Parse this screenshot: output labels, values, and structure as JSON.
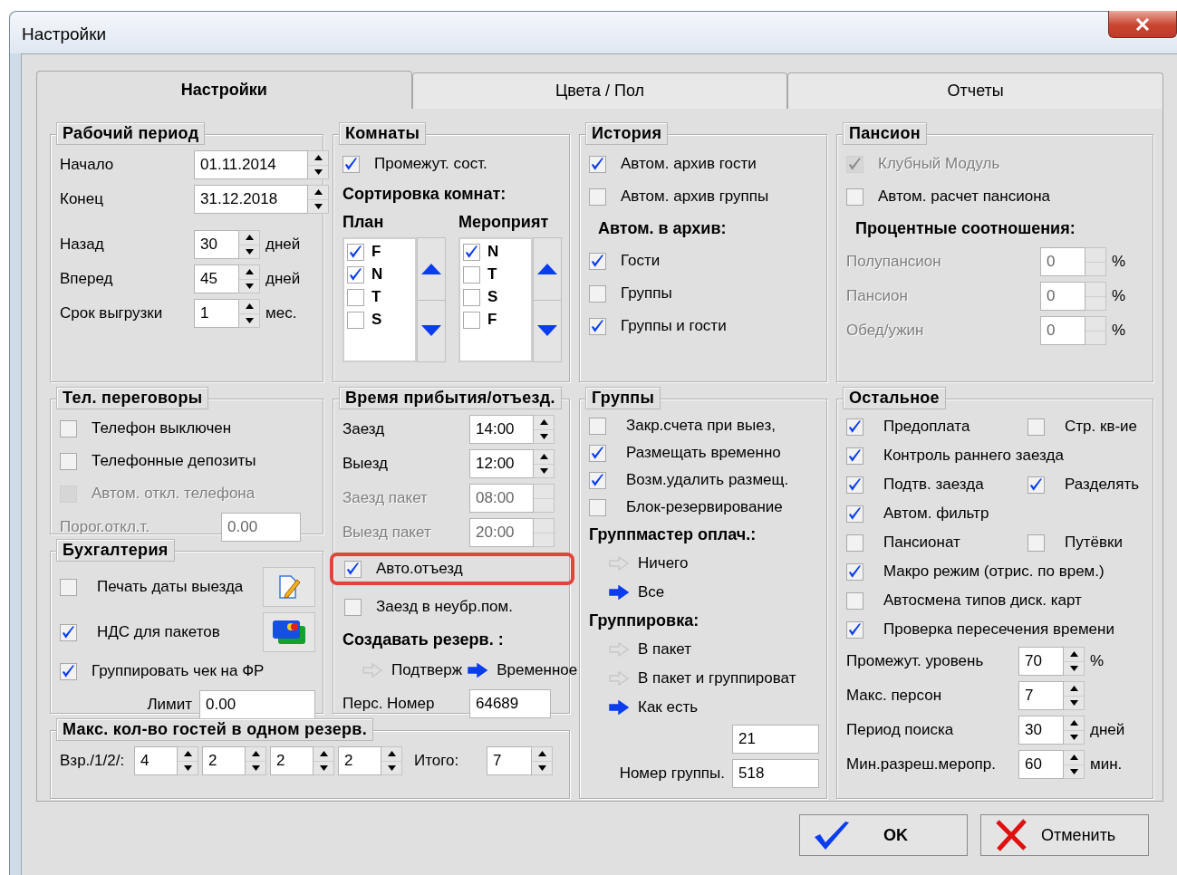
{
  "window": {
    "title": "Настройки"
  },
  "tabs": [
    {
      "label": "Настройки",
      "selected": true
    },
    {
      "label": "Цвета / Пол",
      "selected": false
    },
    {
      "label": "Отчеты",
      "selected": false
    }
  ],
  "groups": [
    {
      "title": "Рабочий период",
      "items": [
        {
          "kind": "spin",
          "label": "Начало",
          "value": "01.11.2014"
        },
        {
          "kind": "spin",
          "label": "Конец",
          "value": "31.12.2018"
        },
        {
          "kind": "gap"
        },
        {
          "kind": "spin",
          "label": "Назад",
          "value": "30",
          "unit": "дней"
        },
        {
          "kind": "spin",
          "label": "Вперед",
          "value": "45",
          "unit": "дней"
        },
        {
          "kind": "spin",
          "label": "Срок выгрузки",
          "value": "1",
          "unit": "мес."
        }
      ]
    },
    {
      "title": "Комнаты",
      "items": [
        {
          "kind": "checkbox",
          "label": "Промежут. сост.",
          "checked": true
        },
        {
          "kind": "heading",
          "text": "Сортировка комнат:"
        },
        {
          "kind": "sorter",
          "lists": [
            {
              "title": "План",
              "entries": [
                {
                  "label": "F",
                  "checked": true
                },
                {
                  "label": "N",
                  "checked": true
                },
                {
                  "label": "T",
                  "checked": false
                },
                {
                  "label": "S",
                  "checked": false
                }
              ]
            },
            {
              "title": "Мероприят",
              "entries": [
                {
                  "label": "N",
                  "checked": true
                },
                {
                  "label": "T",
                  "checked": false
                },
                {
                  "label": "S",
                  "checked": false
                },
                {
                  "label": "F",
                  "checked": false
                }
              ]
            }
          ]
        }
      ]
    },
    {
      "title": "История",
      "items": [
        {
          "kind": "checkbox",
          "label": "Автом. архив гости",
          "checked": true
        },
        {
          "kind": "checkbox",
          "label": "Автом. архив группы",
          "checked": false
        },
        {
          "kind": "heading",
          "text": "Автом. в архив:"
        },
        {
          "kind": "checkbox",
          "label": "Гости",
          "checked": true
        },
        {
          "kind": "checkbox",
          "label": "Группы",
          "checked": false
        },
        {
          "kind": "checkbox",
          "label": "Группы и гости",
          "checked": true
        }
      ]
    },
    {
      "title": "Пансион",
      "items": [
        {
          "kind": "checkbox",
          "label": "Клубный Модуль",
          "checked": true,
          "disabled": true
        },
        {
          "kind": "checkbox",
          "label": "Автом. расчет пансиона",
          "checked": false,
          "disabled": false
        },
        {
          "kind": "heading",
          "text": "Процентные соотношения:",
          "disabled": false
        },
        {
          "kind": "spin",
          "label": "Полупансион",
          "value": "0",
          "unit": "%",
          "disabled": true
        },
        {
          "kind": "spin",
          "label": "Пансион",
          "value": "0",
          "unit": "%",
          "disabled": true
        },
        {
          "kind": "spin",
          "label": "Обед/ужин",
          "value": "0",
          "unit": "%",
          "disabled": true
        }
      ]
    },
    {
      "title": "Тел. переговоры",
      "items": [
        {
          "kind": "checkbox",
          "label": "Телефон выключен",
          "checked": false,
          "disabled": false
        },
        {
          "kind": "checkbox",
          "label": "Телефонные депозиты",
          "checked": false,
          "disabled": false
        },
        {
          "kind": "checkbox",
          "label": "Автом. откл. телефона",
          "checked": false,
          "disabled": true
        },
        {
          "kind": "field",
          "label": "Порог.откл.т.",
          "value": "0.00",
          "disabled": true
        }
      ]
    },
    {
      "title": "Время прибытия/отъезд.",
      "items": [
        {
          "kind": "spin",
          "label": "Заезд",
          "value": "14:00",
          "disabled": false
        },
        {
          "kind": "spin",
          "label": "Выезд",
          "value": "12:00",
          "disabled": false
        },
        {
          "kind": "spin",
          "label": "Заезд пакет",
          "value": "08:00",
          "disabled": true
        },
        {
          "kind": "spin",
          "label": "Выезд пакет",
          "value": "20:00",
          "disabled": true
        },
        {
          "kind": "checkbox",
          "label": "Авто.отъезд",
          "checked": true,
          "disabled": false,
          "highlighted": true
        },
        {
          "kind": "checkbox",
          "label": "Заезд в неубр.пом.",
          "checked": false,
          "disabled": false,
          "highlighted": false
        },
        {
          "kind": "heading",
          "text": "Создавать резерв. :",
          "disabled": false
        },
        {
          "kind": "option-row",
          "options": [
            {
              "label": "Подтверж",
              "selected": false
            },
            {
              "label": "Временное",
              "selected": true
            }
          ]
        },
        {
          "kind": "field",
          "label": "Перс. Номер",
          "value": "64689",
          "disabled": false
        }
      ]
    },
    {
      "title": "Группы",
      "items": [
        {
          "kind": "checkbox",
          "label": "Закр.счета при выез,",
          "checked": false
        },
        {
          "kind": "checkbox",
          "label": "Размещать временно",
          "checked": true
        },
        {
          "kind": "checkbox",
          "label": "Возм.удалить размещ.",
          "checked": true
        },
        {
          "kind": "checkbox",
          "label": "Блок-резервирование",
          "checked": false
        },
        {
          "kind": "heading",
          "text": "Группмастер оплач.:"
        },
        {
          "kind": "option",
          "label": "Ничего",
          "selected": false
        },
        {
          "kind": "option",
          "label": "Все",
          "selected": true
        },
        {
          "kind": "heading",
          "text": "Группировка:"
        },
        {
          "kind": "option",
          "label": "В пакет",
          "selected": false
        },
        {
          "kind": "option",
          "label": "В пакет и группироват",
          "selected": false
        },
        {
          "kind": "option",
          "label": "Как есть",
          "selected": true
        },
        {
          "kind": "field",
          "value": "21"
        },
        {
          "kind": "field",
          "label": "Номер группы.",
          "value": "518"
        }
      ]
    },
    {
      "title": "Остальное",
      "items": [
        {
          "kind": "row",
          "items": [
            {
              "kind": "checkbox",
              "label": "Предоплата",
              "checked": true
            },
            {
              "kind": "checkbox",
              "label": "Стр. кв-ие",
              "checked": false
            }
          ]
        },
        {
          "kind": "checkbox",
          "label": "Контроль раннего заезда",
          "checked": true
        },
        {
          "kind": "row",
          "items": [
            {
              "kind": "checkbox",
              "label": "Подтв. заезда",
              "checked": true
            },
            {
              "kind": "checkbox",
              "label": "Разделять",
              "checked": true
            }
          ]
        },
        {
          "kind": "checkbox",
          "label": "Автом. фильтр",
          "checked": true
        },
        {
          "kind": "row",
          "items": [
            {
              "kind": "checkbox",
              "label": "Пансионат",
              "checked": false
            },
            {
              "kind": "checkbox",
              "label": "Путёвки",
              "checked": false
            }
          ]
        },
        {
          "kind": "checkbox",
          "label": "Макро режим (отрис. по врем.)",
          "checked": true
        },
        {
          "kind": "checkbox",
          "label": "Автосмена типов диск. карт",
          "checked": false
        },
        {
          "kind": "checkbox",
          "label": "Проверка пересечения времени",
          "checked": true
        },
        {
          "kind": "spin",
          "label": "Промежут. уровень",
          "value": "70",
          "unit": "%"
        },
        {
          "kind": "spin",
          "label": "Макс. персон",
          "value": "7"
        },
        {
          "kind": "spin",
          "label": "Период поиска",
          "value": "30",
          "unit": "дней"
        },
        {
          "kind": "spin",
          "label": "Мин.разреш.меропр.",
          "value": "60",
          "unit": "мин."
        }
      ]
    },
    {
      "title": "Бухгалтерия",
      "items": [
        {
          "kind": "checkbox-tool",
          "label": "Печать даты выезда",
          "checked": false
        },
        {
          "kind": "checkbox-tool",
          "label": "НДС для пакетов",
          "checked": true
        },
        {
          "kind": "checkbox",
          "label": "Группировать чек на ФР",
          "checked": true
        },
        {
          "kind": "field",
          "label": "Лимит",
          "value": "0.00"
        }
      ]
    },
    {
      "title": "Макс. кол-во гостей в одном резерв.",
      "items": [
        {
          "kind": "multi-spin",
          "label": "Взр./1/2/:",
          "values": [
            "4",
            "2",
            "2",
            "2"
          ]
        },
        {
          "kind": "spin",
          "label": "Итого:",
          "value": "7"
        }
      ]
    }
  ],
  "buttons": [
    {
      "kind": "ok",
      "label": "OK"
    },
    {
      "kind": "cancel",
      "label": "Отменить"
    }
  ]
}
